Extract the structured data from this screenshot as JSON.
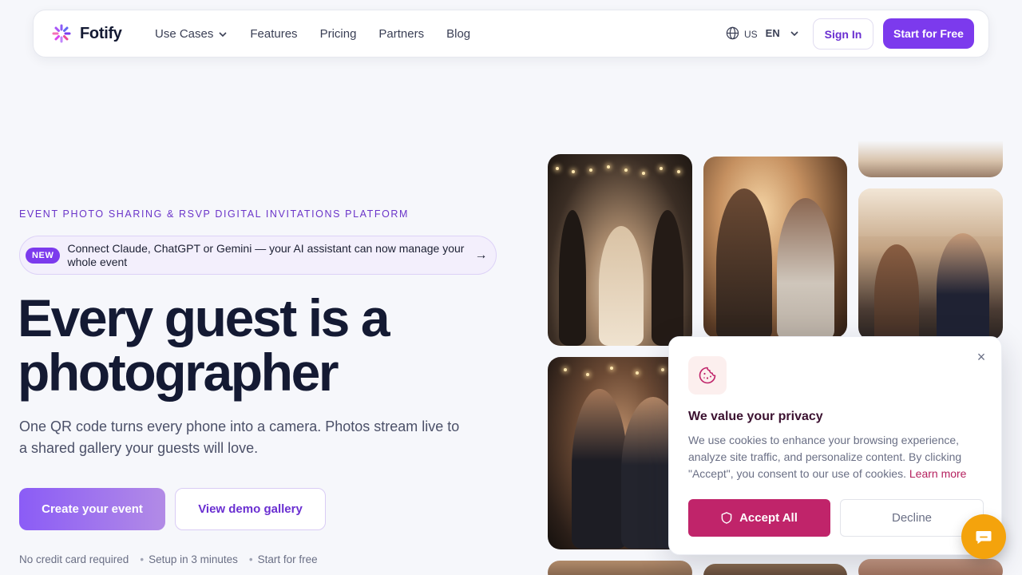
{
  "nav": {
    "brand": "Fotify",
    "links": [
      {
        "label": "Use Cases",
        "has_dropdown": true
      },
      {
        "label": "Features"
      },
      {
        "label": "Pricing"
      },
      {
        "label": "Partners"
      },
      {
        "label": "Blog"
      }
    ],
    "language": {
      "region": "US",
      "code": "EN",
      "icon": "globe-icon"
    },
    "sign_in": "Sign In",
    "start_free": "Start for Free"
  },
  "hero": {
    "eyebrow": "EVENT PHOTO SHARING & RSVP DIGITAL INVITATIONS PLATFORM",
    "announcement": {
      "badge": "NEW",
      "text": "Connect Claude, ChatGPT or Gemini — your AI assistant can now manage your whole event",
      "arrow": "→"
    },
    "headline": "Every guest is a photographer",
    "subhead": "One QR code turns every phone into a camera. Photos stream live to a shared gallery your guests will love.",
    "cta_primary": "Create your event",
    "cta_secondary": "View demo gallery",
    "trust": [
      "No credit card required",
      "Setup in 3 minutes",
      "Start for free"
    ]
  },
  "cookie_banner": {
    "title": "We value your privacy",
    "body": "We use cookies to enhance your browsing experience, analyze site traffic, and personalize content. By clicking \"Accept\", you consent to our use of cookies.",
    "learn_more": "Learn more",
    "accept": "Accept All",
    "decline": "Decline",
    "close_symbol": "×"
  },
  "colors": {
    "brand_purple": "#7c3aed",
    "accept_magenta": "#c0246a",
    "chat_orange": "#f4a30c",
    "headline": "#141a33"
  }
}
